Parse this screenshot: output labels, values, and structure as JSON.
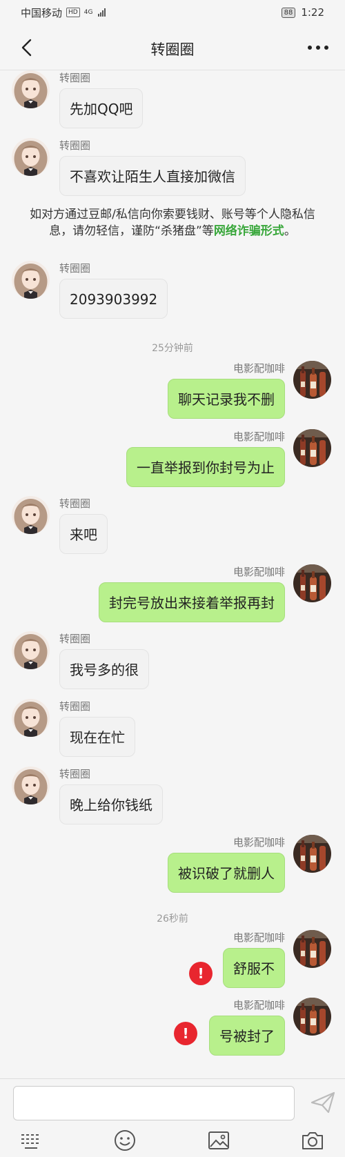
{
  "status_bar": {
    "carrier": "中国移动",
    "hd": "HD",
    "network": "4G",
    "battery": "88",
    "time": "1:22"
  },
  "header": {
    "title": "转圈圈",
    "back_icon": "chevron-left-icon",
    "more_icon": "more-dots-icon"
  },
  "contacts": {
    "other_name": "转圈圈",
    "me_name": "电影配咖啡"
  },
  "messages": [
    {
      "side": "left",
      "text": "先加QQ吧"
    },
    {
      "side": "left",
      "text": "不喜欢让陌生人直接加微信"
    },
    {
      "side": "left",
      "text": "2093903992"
    },
    {
      "side": "right",
      "text": "聊天记录我不删"
    },
    {
      "side": "right",
      "text": "一直举报到你封号为止"
    },
    {
      "side": "left",
      "text": "来吧"
    },
    {
      "side": "right",
      "text": "封完号放出来接着举报再封"
    },
    {
      "side": "left",
      "text": "我号多的很"
    },
    {
      "side": "left",
      "text": "现在在忙"
    },
    {
      "side": "left",
      "text": "晚上给你钱纸"
    },
    {
      "side": "right",
      "text": "被识破了就删人"
    },
    {
      "side": "right",
      "text": "舒服不",
      "failed": true
    },
    {
      "side": "right",
      "text": "号被封了",
      "failed": true
    }
  ],
  "notice": {
    "text": "如对方通过豆邮/私信向你索要钱财、账号等个人隐私信息，请勿轻信，谨防“杀猪盘”等",
    "link": "网络诈骗形式",
    "tail": "。"
  },
  "timestamps": [
    "25分钟前",
    "26秒前"
  ],
  "error_mark": "!",
  "input": {
    "placeholder": ""
  },
  "toolbar": [
    "keyboard-icon",
    "emoji-icon",
    "image-icon",
    "camera-icon"
  ],
  "colors": {
    "my_bubble": "#b8f08c",
    "their_bubble": "#f2f2f2",
    "link": "#39a73b",
    "error": "#e8262f"
  }
}
